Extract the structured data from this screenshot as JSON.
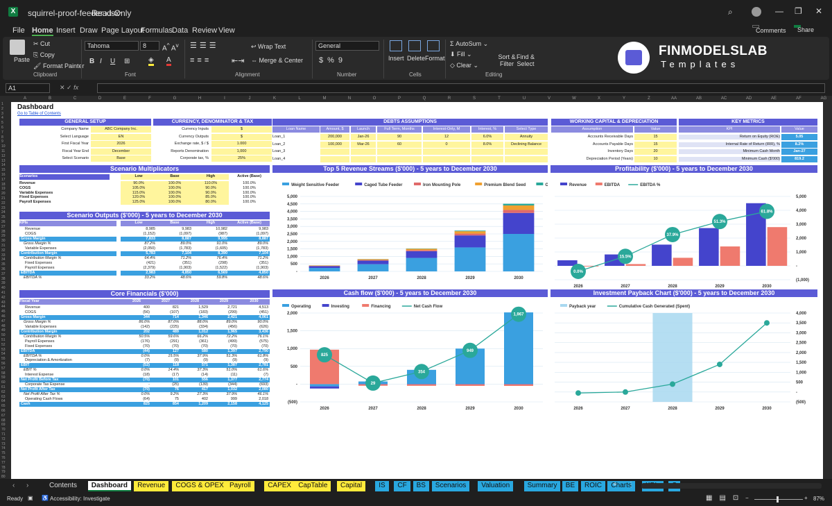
{
  "window": {
    "filename": "squirrel-proof-feeder.xlsx",
    "mode": "Read-Only"
  },
  "menu": [
    "File",
    "Home",
    "Insert",
    "Draw",
    "Page Layout",
    "Formulas",
    "Data",
    "Review",
    "View"
  ],
  "title_buttons": {
    "comments": "Comments",
    "share": "Share"
  },
  "ribbon": {
    "paste": "Paste",
    "cut": "Cut",
    "copy": "Copy",
    "format_painter": "Format Painter",
    "clipboard": "Clipboard",
    "font_name": "Tahoma",
    "font_size": "8",
    "font": "Font",
    "wrap_text": "Wrap Text",
    "merge_center": "Merge & Center",
    "alignment": "Alignment",
    "number_format": "General",
    "number": "Number",
    "insert": "Insert",
    "delete": "Delete",
    "format": "Format",
    "cells": "Cells",
    "autosum": "AutoSum",
    "fill": "Fill",
    "clear": "Clear",
    "sort_filter": "Sort & Filter",
    "find_select": "Find & Select",
    "editing": "Editing"
  },
  "brand": {
    "name": "FINMODELSLAB",
    "sub": "Templates"
  },
  "name_box": "A1",
  "columns": [
    "A",
    "B",
    "C",
    "D",
    "E",
    "F",
    "G",
    "H",
    "I",
    "J",
    "K",
    "L",
    "M",
    "N",
    "O",
    "P",
    "Q",
    "R",
    "S",
    "T",
    "U",
    "V",
    "W",
    "X",
    "Y",
    "Z",
    "AA",
    "AB",
    "AC",
    "AD",
    "AE",
    "AF",
    "AG"
  ],
  "sheet": {
    "title": "Dashboard",
    "toc_link": "Go to Table of Contents",
    "general_setup": {
      "title": "GENERAL SETUP",
      "rows": [
        [
          "Company Name",
          "ABC Company Inc."
        ],
        [
          "Select Language",
          "EN"
        ],
        [
          "First Fiscal Year",
          "2026"
        ],
        [
          "Fiscal Year End",
          "December"
        ],
        [
          "Select Scenario",
          "Base"
        ]
      ]
    },
    "currency": {
      "title": "CURRENCY, DENOMINATOR & TAX",
      "rows": [
        [
          "Currency Inputs",
          "$"
        ],
        [
          "Currency Outputs",
          "$"
        ],
        [
          "Exchange rate, $ / $",
          "1.000"
        ],
        [
          "Reports Denomination",
          "1,000"
        ],
        [
          "Corporate tax, %",
          "25%"
        ]
      ]
    },
    "debts": {
      "title": "DEBTS ASSUMPTIONS",
      "headers": [
        "Loan Name",
        "Amount, $",
        "Launch",
        "Full Term, Months",
        "Interest-Only, M",
        "Interest, %",
        "Select Type"
      ],
      "rows": [
        [
          "Loan_1",
          "200,000",
          "Jan-26",
          "90",
          "12",
          "6.0%",
          "Annuity"
        ],
        [
          "Loan_2",
          "100,000",
          "Mar-26",
          "60",
          "0",
          "8.0%",
          "Declining Balance"
        ],
        [
          "Loan_3",
          "",
          "",
          "",
          "",
          "",
          ""
        ],
        [
          "Loan_4",
          "",
          "",
          "",
          "",
          "",
          ""
        ]
      ]
    },
    "working_capital": {
      "title": "WORKING CAPITAL & DEPRECIATION",
      "headers": [
        "Assumption",
        "Value"
      ],
      "rows": [
        [
          "Accounts Receivable Days",
          "15"
        ],
        [
          "Accounts Payable Days",
          "15"
        ],
        [
          "Inventory Days",
          "20"
        ],
        [
          "Depreciation Period (Years)",
          "10"
        ]
      ]
    },
    "key_metrics": {
      "title": "KEY METRICS",
      "headers": [
        "KPI",
        "Value"
      ],
      "rows": [
        [
          "Return on Equity (ROE)",
          "5.05"
        ],
        [
          "Internal Rate of Return (IRR), %",
          "8.2%"
        ],
        [
          "Minimum Cash Month",
          "Jan-27"
        ],
        [
          "Minimum Cash ($'000)",
          "819.2"
        ]
      ]
    },
    "scenario_multipliers": {
      "title": "Scenario Multiplicators",
      "headers": [
        "Scenarios",
        "Low",
        "Base",
        "High",
        "Active (Base)"
      ],
      "rows": [
        [
          "Revenue",
          "90.0%",
          "100.0%",
          "110.0%",
          "100.0%"
        ],
        [
          "COGS",
          "105.0%",
          "100.0%",
          "90.0%",
          "100.0%"
        ],
        [
          "Variable Expenses",
          "115.0%",
          "100.0%",
          "90.0%",
          "100.0%"
        ],
        [
          "Fixed Expenses",
          "120.0%",
          "100.0%",
          "85.0%",
          "100.0%"
        ],
        [
          "Payroll Expenses",
          "125.0%",
          "100.0%",
          "80.0%",
          "100.0%"
        ]
      ]
    },
    "scenario_outputs": {
      "title": "Scenario Outputs ($'000) - 5 years to December 2030",
      "headers": [
        "KPIs",
        "Low",
        "Base",
        "High",
        "Active (Base)"
      ],
      "rows": [
        [
          "Revenue",
          "8,985",
          "9,983",
          "10,982",
          "9,983",
          0
        ],
        [
          "COGS",
          "(1,152)",
          "(1,097)",
          "(987)",
          "(1,097)",
          0
        ],
        [
          "Gross Margin",
          "7,833",
          "8,887",
          "9,995",
          "8,887",
          1
        ],
        [
          "Gross Margin %",
          "87.2%",
          "89.0%",
          "91.0%",
          "89.0%",
          2
        ],
        [
          "Variable Expenses",
          "(2,050)",
          "(1,783)",
          "(1,605)",
          "(1,783)",
          0
        ],
        [
          "Contribution Margin",
          "5,783",
          "7,104",
          "8,390",
          "7,104",
          1
        ],
        [
          "Contribution Margin %",
          "64.4%",
          "71.2%",
          "76.4%",
          "71.2%",
          2
        ],
        [
          "Fixed Expenses",
          "(421)",
          "(351)",
          "(298)",
          "(351)",
          0
        ],
        [
          "Payroll Expenses",
          "(2,379)",
          "(1,903)",
          "(1,522)",
          "(1,903)",
          0
        ],
        [
          "EBITDA",
          "2,983",
          "4,850",
          "6,569",
          "4,850",
          1
        ],
        [
          "EBITDA %",
          "33.2%",
          "48.6%",
          "59.8%",
          "48.6%",
          2
        ]
      ]
    },
    "core_financials": {
      "title": "Core Financials ($'000)",
      "headers": [
        "Fiscal Year",
        "2026",
        "2027",
        "2028",
        "2029",
        "2030"
      ],
      "rows": [
        [
          "Revenue",
          "400",
          "821",
          "1,529",
          "2,721",
          "4,513",
          0
        ],
        [
          "COGS",
          "(56)",
          "(107)",
          "(183)",
          "(299)",
          "(451)",
          0
        ],
        [
          "Gross Margin",
          "344",
          "714",
          "1,346",
          "2,421",
          "4,061",
          1
        ],
        [
          "Gross Margin %",
          "86.0%",
          "87.0%",
          "88.0%",
          "89.0%",
          "90.0%",
          2
        ],
        [
          "Variable Expenses",
          "(142)",
          "(225)",
          "(334)",
          "(456)",
          "(626)",
          0
        ],
        [
          "Contribution Margin",
          "202",
          "489",
          "1,012",
          "1,965",
          "3,436",
          1
        ],
        [
          "Contribution Margin %",
          "50.5%",
          "59.6%",
          "66.2%",
          "72.2%",
          "76.1%",
          2
        ],
        [
          "Payroll Expenses",
          "(176)",
          "(291)",
          "(361)",
          "(499)",
          "(575)",
          0
        ],
        [
          "Fixed Expenses",
          "(70)",
          "(70)",
          "(70)",
          "(70)",
          "(70)",
          0
        ],
        [
          "EBITDA",
          "(44)",
          "127",
          "580",
          "1,397",
          "2,790",
          1
        ],
        [
          "EBITDA %",
          "0.0%",
          "15.5%",
          "37.9%",
          "51.3%",
          "61.8%",
          2
        ],
        [
          "Depreciation & Amortization",
          "(7)",
          "(9)",
          "(9)",
          "(9)",
          "(9)",
          0
        ],
        [
          "EBIT",
          "(52)",
          "118",
          "571",
          "1,387",
          "2,781",
          1
        ],
        [
          "EBIT %",
          "0.0%",
          "14.4%",
          "37.3%",
          "51.0%",
          "61.6%",
          2
        ],
        [
          "Interest Expense",
          "(18)",
          "(17)",
          "(14)",
          "(11)",
          "(7)",
          0
        ],
        [
          "Net Profit Before Tax",
          "(70)",
          "101",
          "556",
          "1,377",
          "2,774",
          1
        ],
        [
          "Corporate Tax Expense",
          "-",
          "(25)",
          "(139)",
          "(344)",
          "(693)",
          0
        ],
        [
          "Net Profit After Tax",
          "(70)",
          "76",
          "417",
          "1,032",
          "2,080",
          1
        ],
        [
          "Net Profit After Tax %",
          "0.0%",
          "9.2%",
          "27.3%",
          "37.9%",
          "46.1%",
          2
        ],
        [
          "Operating Cash Flows",
          "(64)",
          "75",
          "402",
          "999",
          "2,018",
          0
        ],
        [
          "Cash",
          "825",
          "854",
          "1,209",
          "2,158",
          "4,125",
          1
        ]
      ]
    }
  },
  "chart_data": [
    {
      "type": "bar",
      "title": "Top 5 Revenue Streams ($'000) - 5 years to December 2030",
      "categories": [
        "2026",
        "2027",
        "2028",
        "2029",
        "2030"
      ],
      "stacked": true,
      "ylim": [
        0,
        5000
      ],
      "yticks": [
        "-",
        "500",
        "1,000",
        "1,500",
        "2,000",
        "2,500",
        "3,000",
        "3,500",
        "4,000",
        "4,500",
        "5,000"
      ],
      "series": [
        {
          "name": "Weight Sensitive Feeder",
          "color": "#3aa0e0",
          "values": [
            230,
            480,
            900,
            1600,
            2500
          ]
        },
        {
          "name": "Caged Tube Feeder",
          "color": "#4444cc",
          "values": [
            120,
            240,
            450,
            800,
            1400
          ]
        },
        {
          "name": "Iron Mounting Pole",
          "color": "#e06a6a",
          "values": [
            20,
            40,
            70,
            120,
            200
          ]
        },
        {
          "name": "Premium Blend Seed",
          "color": "#f0a030",
          "values": [
            25,
            50,
            90,
            160,
            300
          ]
        },
        {
          "name": "Other Revenue",
          "color": "#2aa89a",
          "values": [
            5,
            11,
            19,
            41,
            113
          ]
        }
      ]
    },
    {
      "type": "bar",
      "title": "Profitability ($'000) - 5 years to December 2030",
      "categories": [
        "2026",
        "2027",
        "2028",
        "2029",
        "2030"
      ],
      "ylim": [
        -1000,
        5000
      ],
      "yticks": [
        "(1,000)",
        "-",
        "1,000",
        "2,000",
        "3,000",
        "4,000",
        "5,000"
      ],
      "series": [
        {
          "name": "Revenue",
          "color": "#4444cc",
          "values": [
            400,
            821,
            1529,
            2721,
            4513
          ]
        },
        {
          "name": "EBITDA",
          "color": "#ef7a6e",
          "values": [
            -44,
            127,
            580,
            1397,
            2790
          ]
        },
        {
          "name": "EBITDA %",
          "color": "#2aa89a",
          "values": [
            0.0,
            15.5,
            37.9,
            51.3,
            61.8
          ],
          "labels": [
            "0.0%",
            "15.5%",
            "37.9%",
            "51.3%",
            "61.8%"
          ]
        }
      ]
    },
    {
      "type": "bar",
      "title": "Cash flow ($'000) - 5 years to December 2030",
      "categories": [
        "2026",
        "2027",
        "2028",
        "2029",
        "2030"
      ],
      "ylim": [
        -500,
        2000
      ],
      "yticks": [
        "(500)",
        "-",
        "500",
        "1,000",
        "1,500",
        "2,000"
      ],
      "series": [
        {
          "name": "Operating",
          "color": "#3aa0e0",
          "values": [
            -64,
            75,
            402,
            999,
            2018
          ]
        },
        {
          "name": "Investing",
          "color": "#4444cc",
          "values": [
            -60,
            -5,
            -5,
            -5,
            -5
          ]
        },
        {
          "name": "Financing",
          "color": "#ef7a6e",
          "values": [
            969,
            -41,
            -43,
            -45,
            -46
          ]
        },
        {
          "name": "Net Cash Flow",
          "color": "#2aa89a",
          "values": [
            825,
            29,
            354,
            949,
            1967
          ],
          "labels": [
            "825",
            "29",
            "354",
            "949",
            "1,967"
          ]
        }
      ]
    },
    {
      "type": "bar",
      "title": "Investment Payback Chart ($'000) - 5 years to December 2030",
      "categories": [
        "2026",
        "2027",
        "2028",
        "2029",
        "2030"
      ],
      "ylim": [
        -500,
        4000
      ],
      "yticks": [
        "(500)",
        "-",
        "500",
        "1,000",
        "1,500",
        "2,000",
        "2,500",
        "3,000",
        "3,500",
        "4,000"
      ],
      "series": [
        {
          "name": "Payback year",
          "color": "#a8d8f0",
          "values": [
            0,
            0,
            4000,
            0,
            0
          ]
        },
        {
          "name": "Cumulative Cash Generated (Spent)",
          "color": "#2aa89a",
          "values": [
            -50,
            0,
            400,
            1400,
            3500
          ]
        }
      ]
    }
  ],
  "tabs": [
    {
      "label": "Contents",
      "color": "#1f1f1f",
      "text": "#ddd"
    },
    {
      "label": "Dashboard",
      "color": "#ffffff",
      "text": "#111",
      "active": true
    },
    {
      "label": "Revenue",
      "color": "#ffeb3b"
    },
    {
      "label": "COGS & OPEX",
      "color": "#ffeb3b"
    },
    {
      "label": "Payroll",
      "color": "#ffeb3b"
    },
    {
      "label": "CAPEX",
      "color": "#ffeb3b"
    },
    {
      "label": "CapTable",
      "color": "#ffeb3b"
    },
    {
      "label": "Capital",
      "color": "#ffeb3b"
    },
    {
      "label": "IS",
      "color": "#29a8e0"
    },
    {
      "label": "CF",
      "color": "#29a8e0"
    },
    {
      "label": "BS",
      "color": "#29a8e0"
    },
    {
      "label": "Scenarios",
      "color": "#29a8e0"
    },
    {
      "label": "Valuation",
      "color": "#29a8e0"
    },
    {
      "label": "Summary",
      "color": "#29a8e0"
    },
    {
      "label": "BE",
      "color": "#29a8e0"
    },
    {
      "label": "ROIC",
      "color": "#29a8e0"
    },
    {
      "label": "Charts",
      "color": "#29a8e0"
    },
    {
      "label": "KPIs",
      "color": "#29a8e0"
    },
    {
      "label": "S",
      "color": "#29a8e0"
    }
  ],
  "status": {
    "ready": "Ready",
    "accessibility": "Accessibility: Investigate",
    "zoom": "87%"
  }
}
